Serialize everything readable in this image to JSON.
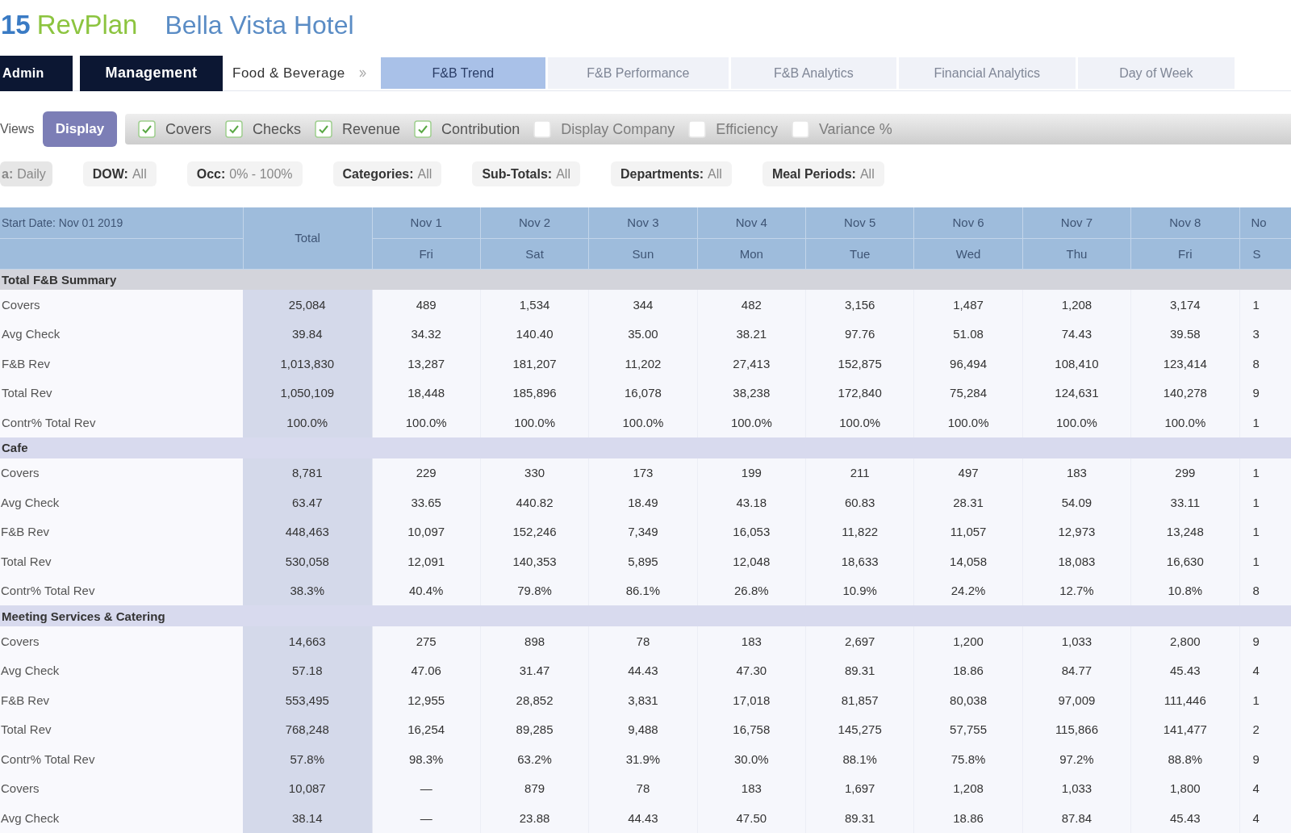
{
  "header": {
    "logo": {
      "mark": "15",
      "name": "RevPlan"
    },
    "hotel": "Bella Vista Hotel"
  },
  "nav": {
    "buttons": [
      "Admin",
      "Management"
    ],
    "breadcrumb": "Food & Beverage",
    "tabs": [
      {
        "label": "F&B Trend",
        "selected": true
      },
      {
        "label": "F&B Performance",
        "selected": false
      },
      {
        "label": "F&B Analytics",
        "selected": false
      },
      {
        "label": "Financial Analytics",
        "selected": false
      },
      {
        "label": "Day of Week",
        "selected": false
      }
    ]
  },
  "views": {
    "label": "Views",
    "button": "Display",
    "options": [
      {
        "label": "Covers",
        "checked": true
      },
      {
        "label": "Checks",
        "checked": true
      },
      {
        "label": "Revenue",
        "checked": true
      },
      {
        "label": "Contribution",
        "checked": true
      },
      {
        "label": "Display Company",
        "checked": false
      },
      {
        "label": "Efficiency",
        "checked": false
      },
      {
        "label": "Variance %",
        "checked": false
      }
    ]
  },
  "filters": [
    {
      "label": "a:",
      "value": "Daily"
    },
    {
      "label": "DOW:",
      "value": "All"
    },
    {
      "label": "Occ:",
      "value": "0% - 100%"
    },
    {
      "label": "Categories:",
      "value": "All"
    },
    {
      "label": "Sub-Totals:",
      "value": "All"
    },
    {
      "label": "Departments:",
      "value": "All"
    },
    {
      "label": "Meal Periods:",
      "value": "All"
    }
  ],
  "table": {
    "corner": "Start Date: Nov 01 2019",
    "total_label": "Total",
    "columns": [
      {
        "date": "Nov 1",
        "day": "Fri"
      },
      {
        "date": "Nov 2",
        "day": "Sat"
      },
      {
        "date": "Nov 3",
        "day": "Sun"
      },
      {
        "date": "Nov 4",
        "day": "Mon"
      },
      {
        "date": "Nov 5",
        "day": "Tue"
      },
      {
        "date": "Nov 6",
        "day": "Wed"
      },
      {
        "date": "Nov 7",
        "day": "Thu"
      },
      {
        "date": "Nov 8",
        "day": "Fri"
      },
      {
        "date": "No",
        "day": "S"
      }
    ],
    "sections": [
      {
        "title": "Total F&B Summary",
        "kind": "summary",
        "rows": [
          {
            "label": "Covers",
            "total": "25,084",
            "values": [
              "489",
              "1,534",
              "344",
              "482",
              "3,156",
              "1,487",
              "1,208",
              "3,174",
              "1"
            ]
          },
          {
            "label": "Avg Check",
            "total": "39.84",
            "values": [
              "34.32",
              "140.40",
              "35.00",
              "38.21",
              "97.76",
              "51.08",
              "74.43",
              "39.58",
              "3"
            ]
          },
          {
            "label": "F&B Rev",
            "total": "1,013,830",
            "values": [
              "13,287",
              "181,207",
              "11,202",
              "27,413",
              "152,875",
              "96,494",
              "108,410",
              "123,414",
              "8"
            ]
          },
          {
            "label": "Total Rev",
            "total": "1,050,109",
            "values": [
              "18,448",
              "185,896",
              "16,078",
              "38,238",
              "172,840",
              "75,284",
              "124,631",
              "140,278",
              "9"
            ]
          },
          {
            "label": "Contr% Total Rev",
            "total": "100.0%",
            "values": [
              "100.0%",
              "100.0%",
              "100.0%",
              "100.0%",
              "100.0%",
              "100.0%",
              "100.0%",
              "100.0%",
              "1"
            ]
          }
        ]
      },
      {
        "title": "Cafe",
        "kind": "group",
        "rows": [
          {
            "label": "Covers",
            "total": "8,781",
            "values": [
              "229",
              "330",
              "173",
              "199",
              "211",
              "497",
              "183",
              "299",
              "1"
            ]
          },
          {
            "label": "Avg Check",
            "total": "63.47",
            "values": [
              "33.65",
              "440.82",
              "18.49",
              "43.18",
              "60.83",
              "28.31",
              "54.09",
              "33.11",
              "1"
            ]
          },
          {
            "label": "F&B Rev",
            "total": "448,463",
            "values": [
              "10,097",
              "152,246",
              "7,349",
              "16,053",
              "11,822",
              "11,057",
              "12,973",
              "13,248",
              "1"
            ]
          },
          {
            "label": "Total Rev",
            "total": "530,058",
            "values": [
              "12,091",
              "140,353",
              "5,895",
              "12,048",
              "18,633",
              "14,058",
              "18,083",
              "16,630",
              "1"
            ]
          },
          {
            "label": "Contr% Total Rev",
            "total": "38.3%",
            "values": [
              "40.4%",
              "79.8%",
              "86.1%",
              "26.8%",
              "10.9%",
              "24.2%",
              "12.7%",
              "10.8%",
              "8"
            ]
          }
        ]
      },
      {
        "title": "Meeting Services & Catering",
        "kind": "group",
        "rows": [
          {
            "label": "Covers",
            "total": "14,663",
            "values": [
              "275",
              "898",
              "78",
              "183",
              "2,697",
              "1,200",
              "1,033",
              "2,800",
              "9"
            ]
          },
          {
            "label": "Avg Check",
            "total": "57.18",
            "values": [
              "47.06",
              "31.47",
              "44.43",
              "47.30",
              "89.31",
              "18.86",
              "84.77",
              "45.43",
              "4"
            ]
          },
          {
            "label": "F&B Rev",
            "total": "553,495",
            "values": [
              "12,955",
              "28,852",
              "3,831",
              "17,018",
              "81,857",
              "80,038",
              "97,009",
              "111,446",
              "1"
            ]
          },
          {
            "label": "Total Rev",
            "total": "768,248",
            "values": [
              "16,254",
              "89,285",
              "9,488",
              "16,758",
              "145,275",
              "57,755",
              "115,866",
              "141,477",
              "2"
            ]
          },
          {
            "label": "Contr% Total Rev",
            "total": "57.8%",
            "values": [
              "98.3%",
              "63.2%",
              "31.9%",
              "30.0%",
              "88.1%",
              "75.8%",
              "97.2%",
              "88.8%",
              "9"
            ]
          },
          {
            "label": "Covers",
            "total": "10,087",
            "values": [
              "—",
              "879",
              "78",
              "183",
              "1,697",
              "1,208",
              "1,033",
              "1,800",
              "4"
            ]
          },
          {
            "label": "Avg Check",
            "total": "38.14",
            "values": [
              "—",
              "23.88",
              "44.43",
              "47.50",
              "89.31",
              "18.86",
              "87.84",
              "45.43",
              "4"
            ]
          }
        ]
      }
    ]
  }
}
